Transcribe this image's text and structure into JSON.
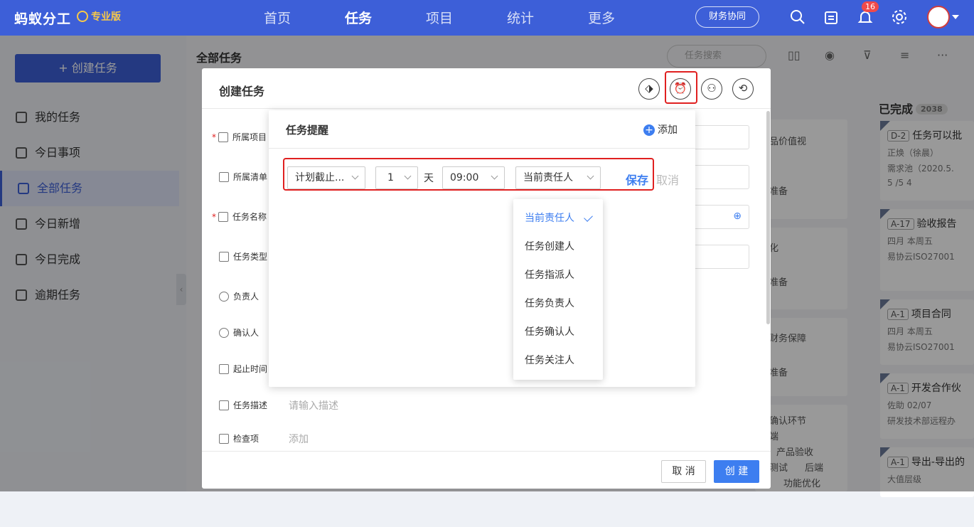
{
  "app": {
    "logo": "蚂蚁分工",
    "edition": "专业版"
  },
  "nav": [
    {
      "label": "首页"
    },
    {
      "label": "任务"
    },
    {
      "label": "项目"
    },
    {
      "label": "统计"
    },
    {
      "label": "更多"
    }
  ],
  "topbar": {
    "finance_button": "财务协同",
    "notification_count": "16"
  },
  "sidebar": {
    "create_button": "+ 创建任务",
    "items": [
      {
        "label": "我的任务"
      },
      {
        "label": "今日事项"
      },
      {
        "label": "全部任务"
      },
      {
        "label": "今日新增"
      },
      {
        "label": "今日完成"
      },
      {
        "label": "逾期任务"
      }
    ]
  },
  "main": {
    "title": "全部任务",
    "search_placeholder": "任务搜索"
  },
  "board_behind": {
    "texts": [
      "品价值视",
      "准备",
      "化",
      "准备",
      "财务保障",
      "准备",
      "确认环节",
      "端",
      "产品验收",
      "测试",
      "后端",
      "功能优化"
    ]
  },
  "done_column": {
    "title": "已完成",
    "count": "2038",
    "cards": [
      {
        "id": "D-2",
        "title": "任务可以批",
        "row1": "正焕（徐晨）",
        "row2": "需求池（2020.5.",
        "row3": "5 /5   4"
      },
      {
        "id": "A-17",
        "title": "验收报告",
        "row1": "四月  本周五",
        "row2": "易协云ISO27001",
        "row3": ""
      },
      {
        "id": "A-1",
        "title": "项目合同",
        "row1": "四月  本周五",
        "row2": "易协云ISO27001",
        "row3": ""
      },
      {
        "id": "A-1",
        "title": "开发合作伙",
        "row1": "佐助  02/07",
        "row2": "研发技术部远程办",
        "row3": ""
      },
      {
        "id": "A-1",
        "title": "导出-导出的",
        "row1": "大值层级",
        "row2": "",
        "row3": ""
      }
    ]
  },
  "modal": {
    "title": "创建任务",
    "fields": [
      {
        "label": "所属项目",
        "required": true
      },
      {
        "label": "所属清单",
        "required": false
      },
      {
        "label": "任务名称",
        "required": true
      },
      {
        "label": "任务类型",
        "required": false
      },
      {
        "label": "负责人",
        "required": false
      },
      {
        "label": "确认人",
        "required": false
      },
      {
        "label": "起止时间",
        "required": false
      },
      {
        "label": "任务描述",
        "required": false,
        "placeholder": "请输入描述"
      },
      {
        "label": "检查项",
        "required": false,
        "placeholder": "添加"
      }
    ],
    "cancel": "取 消",
    "create": "创 建"
  },
  "reminder": {
    "title": "任务提醒",
    "add": "添加",
    "time_basis": "计划截止...",
    "offset": "1",
    "unit": "天",
    "time": "09:00",
    "recipient": "当前责任人",
    "save": "保存",
    "cancel": "取消",
    "options": [
      "当前责任人",
      "任务创建人",
      "任务指派人",
      "任务负责人",
      "任务确认人",
      "任务关注人"
    ]
  },
  "colors": {
    "brand": "#3d5fd8",
    "accent": "#3d7ef0",
    "highlight": "#e02020"
  }
}
